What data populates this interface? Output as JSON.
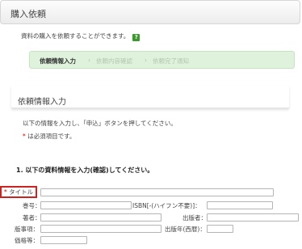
{
  "header": {
    "title": "購入依頼"
  },
  "intro": {
    "text": "資料の購入を依頼することができます。",
    "help_icon": "?"
  },
  "steps": {
    "active": "依頼情報入力",
    "second": "依頼内容確認",
    "third": "依頼完了通知",
    "separator": "›"
  },
  "section": {
    "title": "依頼情報入力"
  },
  "info": {
    "instruction": "以下の情報を入力し、「申込」ボタンを押してください。",
    "required_mark": "*",
    "required_note": "は必須項目です。"
  },
  "form": {
    "heading": "1. 以下の資料情報を入力(確認)してください。",
    "required_mark": "*",
    "title_label": "タイトル",
    "series_label": "巻号：",
    "isbn_label": "ISBN[-(ハイフン不要)]：",
    "author_label": "著者：",
    "publisher_label": "出版者：",
    "edition_label": "版事項：",
    "pubyear_label": "出版年(西暦)：",
    "price_label": "価格等："
  }
}
